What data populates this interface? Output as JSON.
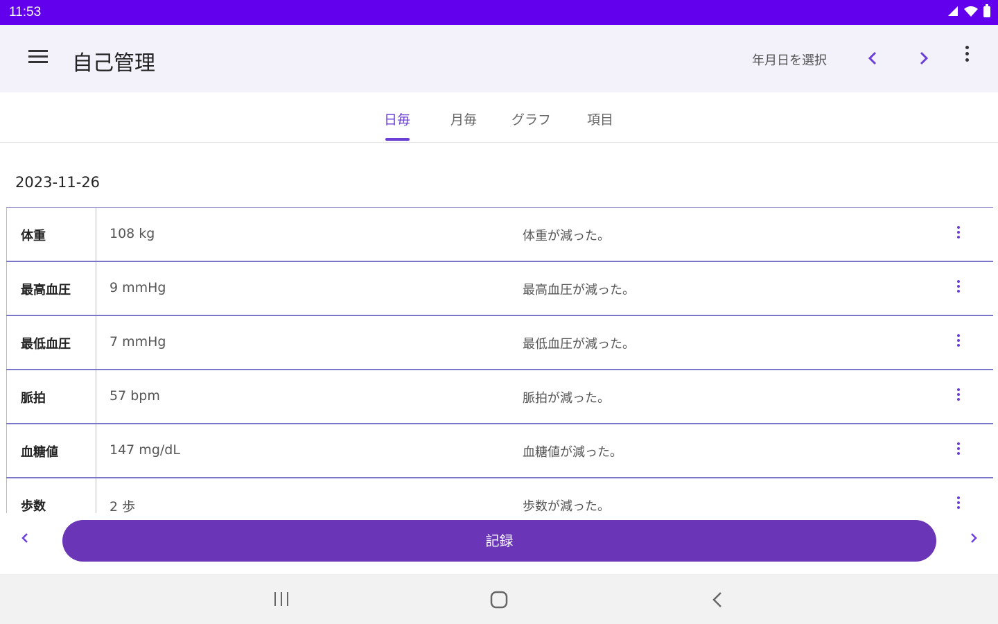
{
  "status_bar": {
    "time": "11:53"
  },
  "app_bar": {
    "title": "自己管理",
    "date_select_label": "年月日を選択"
  },
  "tabs": [
    {
      "label": "日毎",
      "active": true
    },
    {
      "label": "月毎",
      "active": false
    },
    {
      "label": "グラフ",
      "active": false
    },
    {
      "label": "項目",
      "active": false
    }
  ],
  "date": "2023-11-26",
  "records": [
    {
      "label": "体重",
      "value": "108 kg",
      "note": "体重が減った。"
    },
    {
      "label": "最高血圧",
      "value": "9 mmHg",
      "note": "最高血圧が減った。"
    },
    {
      "label": "最低血圧",
      "value": "7 mmHg",
      "note": "最低血圧が減った。"
    },
    {
      "label": "脈拍",
      "value": "57 bpm",
      "note": "脈拍が減った。"
    },
    {
      "label": "血糖値",
      "value": "147 mg/dL",
      "note": "血糖値が減った。"
    },
    {
      "label": "歩数",
      "value": "2 歩",
      "note": "歩数が減った。"
    }
  ],
  "record_button_label": "記録",
  "colors": {
    "status_bar": "#6200ee",
    "accent": "#6b3fd6",
    "button": "#6a35b7",
    "app_bar": "#f3f1fa"
  },
  "icons": {
    "menu": "menu-icon",
    "prev": "chevron-left-icon",
    "next": "chevron-right-icon",
    "overflow": "more-vert-icon",
    "row_more": "more-vert-icon",
    "nav_recent": "recent-apps-icon",
    "nav_home": "home-icon",
    "nav_back": "back-icon"
  }
}
